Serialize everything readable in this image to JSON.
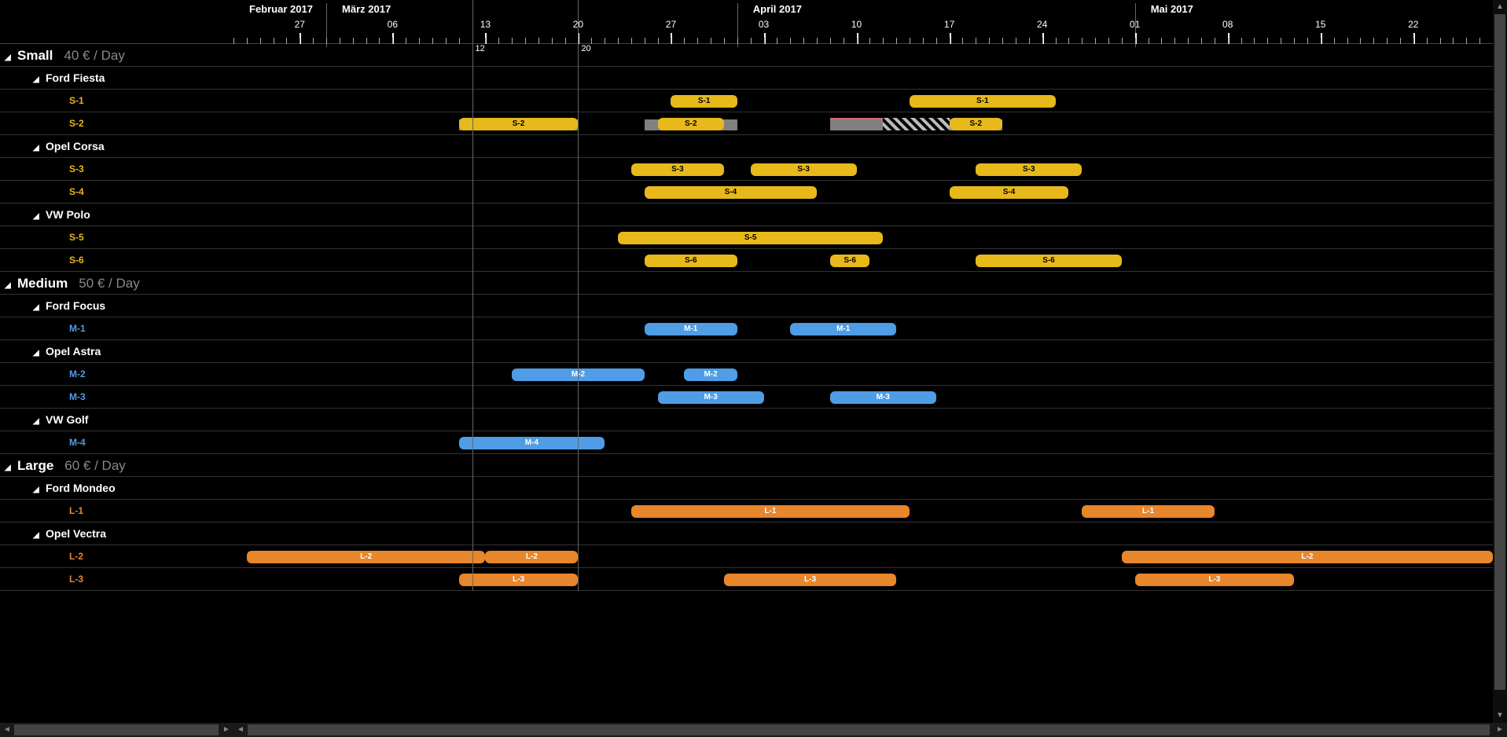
{
  "chart_data": {
    "type": "gantt",
    "title": "",
    "x_axis": {
      "start": "2017-02-22",
      "end": "2017-05-28",
      "unit": "day"
    },
    "colors": {
      "Small": "#e7b91a",
      "Medium": "#4f9de6",
      "Large": "#e8862c"
    },
    "time_markers": [
      {
        "label": "12",
        "date": "2017-03-12"
      },
      {
        "label": "20",
        "date": "2017-03-20"
      }
    ],
    "months": [
      {
        "label": "Februar 2017",
        "start": "2017-02-22",
        "end": "2017-02-28"
      },
      {
        "label": "März 2017",
        "start": "2017-03-01",
        "end": "2017-03-31"
      },
      {
        "label": "April 2017",
        "start": "2017-04-01",
        "end": "2017-04-30"
      },
      {
        "label": "Mai 2017",
        "start": "2017-05-01",
        "end": "2017-05-28"
      }
    ],
    "week_ticks": [
      "27",
      "06",
      "13",
      "20",
      "27",
      "03",
      "10",
      "17",
      "24",
      "01",
      "08",
      "15",
      "22"
    ],
    "week_dates": [
      "2017-02-27",
      "2017-03-06",
      "2017-03-13",
      "2017-03-20",
      "2017-03-27",
      "2017-04-03",
      "2017-04-10",
      "2017-04-17",
      "2017-04-24",
      "2017-05-01",
      "2017-05-08",
      "2017-05-15",
      "2017-05-22"
    ],
    "groups": [
      {
        "name": "Small",
        "price_label": "40  € / Day",
        "class": "c-small",
        "models": [
          {
            "name": "Ford Fiesta",
            "items": [
              {
                "id": "S-1",
                "bars": [
                  {
                    "label": "S-1",
                    "start": "2017-03-27",
                    "end": "2017-04-01"
                  },
                  {
                    "label": "S-1",
                    "start": "2017-04-14",
                    "end": "2017-04-25"
                  }
                ]
              },
              {
                "id": "S-2",
                "bars": [
                  {
                    "label": "S-2",
                    "start": "2017-03-11",
                    "end": "2017-03-20",
                    "under_start": "2017-03-11",
                    "under_end": "2017-03-20"
                  },
                  {
                    "label": "S-2",
                    "start": "2017-03-26",
                    "end": "2017-03-31",
                    "under_start": "2017-03-25",
                    "under_end": "2017-04-01"
                  },
                  {
                    "type": "red",
                    "start": "2017-04-08",
                    "end": "2017-04-12"
                  },
                  {
                    "type": "hatch",
                    "start": "2017-04-12",
                    "end": "2017-04-17",
                    "under_start": "2017-04-08",
                    "under_end": "2017-04-21"
                  },
                  {
                    "label": "S-2",
                    "start": "2017-04-17",
                    "end": "2017-04-21"
                  }
                ]
              }
            ]
          },
          {
            "name": "Opel Corsa",
            "items": [
              {
                "id": "S-3",
                "bars": [
                  {
                    "label": "S-3",
                    "start": "2017-03-24",
                    "end": "2017-03-31"
                  },
                  {
                    "label": "S-3",
                    "start": "2017-04-02",
                    "end": "2017-04-10"
                  },
                  {
                    "label": "S-3",
                    "start": "2017-04-19",
                    "end": "2017-04-27"
                  }
                ]
              },
              {
                "id": "S-4",
                "bars": [
                  {
                    "label": "S-4",
                    "start": "2017-03-25",
                    "end": "2017-04-07"
                  },
                  {
                    "label": "S-4",
                    "start": "2017-04-17",
                    "end": "2017-04-26"
                  }
                ]
              }
            ]
          },
          {
            "name": "VW Polo",
            "items": [
              {
                "id": "S-5",
                "bars": [
                  {
                    "label": "S-5",
                    "start": "2017-03-23",
                    "end": "2017-04-12"
                  }
                ]
              },
              {
                "id": "S-6",
                "bars": [
                  {
                    "label": "S-6",
                    "start": "2017-03-25",
                    "end": "2017-04-01"
                  },
                  {
                    "label": "S-6",
                    "start": "2017-04-08",
                    "end": "2017-04-11"
                  },
                  {
                    "label": "S-6",
                    "start": "2017-04-19",
                    "end": "2017-04-30"
                  }
                ]
              }
            ]
          }
        ]
      },
      {
        "name": "Medium",
        "price_label": "50  € / Day",
        "class": "c-medium",
        "models": [
          {
            "name": "Ford Focus",
            "items": [
              {
                "id": "M-1",
                "bars": [
                  {
                    "label": "M-1",
                    "start": "2017-03-25",
                    "end": "2017-04-01"
                  },
                  {
                    "label": "M-1",
                    "start": "2017-04-05",
                    "end": "2017-04-13"
                  }
                ]
              }
            ]
          },
          {
            "name": "Opel Astra",
            "items": [
              {
                "id": "M-2",
                "bars": [
                  {
                    "label": "M-2",
                    "start": "2017-03-15",
                    "end": "2017-03-25"
                  },
                  {
                    "label": "M-2",
                    "start": "2017-03-28",
                    "end": "2017-04-01"
                  }
                ]
              },
              {
                "id": "M-3",
                "bars": [
                  {
                    "label": "M-3",
                    "start": "2017-03-26",
                    "end": "2017-04-03"
                  },
                  {
                    "label": "M-3",
                    "start": "2017-04-08",
                    "end": "2017-04-16"
                  }
                ]
              }
            ]
          },
          {
            "name": "VW Golf",
            "items": [
              {
                "id": "M-4",
                "bars": [
                  {
                    "label": "M-4",
                    "start": "2017-03-11",
                    "end": "2017-03-22"
                  }
                ]
              }
            ]
          }
        ]
      },
      {
        "name": "Large",
        "price_label": "60  € / Day",
        "class": "c-large",
        "models": [
          {
            "name": "Ford Mondeo",
            "items": [
              {
                "id": "L-1",
                "bars": [
                  {
                    "label": "L-1",
                    "start": "2017-03-24",
                    "end": "2017-04-14"
                  },
                  {
                    "label": "L-1",
                    "start": "2017-04-27",
                    "end": "2017-05-07"
                  }
                ]
              }
            ]
          },
          {
            "name": "Opel Vectra",
            "items": [
              {
                "id": "L-2",
                "bars": [
                  {
                    "label": "L-2",
                    "start": "2017-02-23",
                    "end": "2017-03-13"
                  },
                  {
                    "label": "L-2",
                    "start": "2017-03-13",
                    "end": "2017-03-20"
                  },
                  {
                    "label": "L-2",
                    "start": "2017-04-30",
                    "end": "2017-05-28"
                  }
                ]
              },
              {
                "id": "L-3",
                "bars": [
                  {
                    "label": "L-3",
                    "start": "2017-03-11",
                    "end": "2017-03-20"
                  },
                  {
                    "label": "L-3",
                    "start": "2017-03-31",
                    "end": "2017-04-13"
                  },
                  {
                    "label": "L-3",
                    "start": "2017-05-01",
                    "end": "2017-05-13"
                  }
                ],
                "partial": true
              }
            ]
          }
        ]
      }
    ]
  }
}
